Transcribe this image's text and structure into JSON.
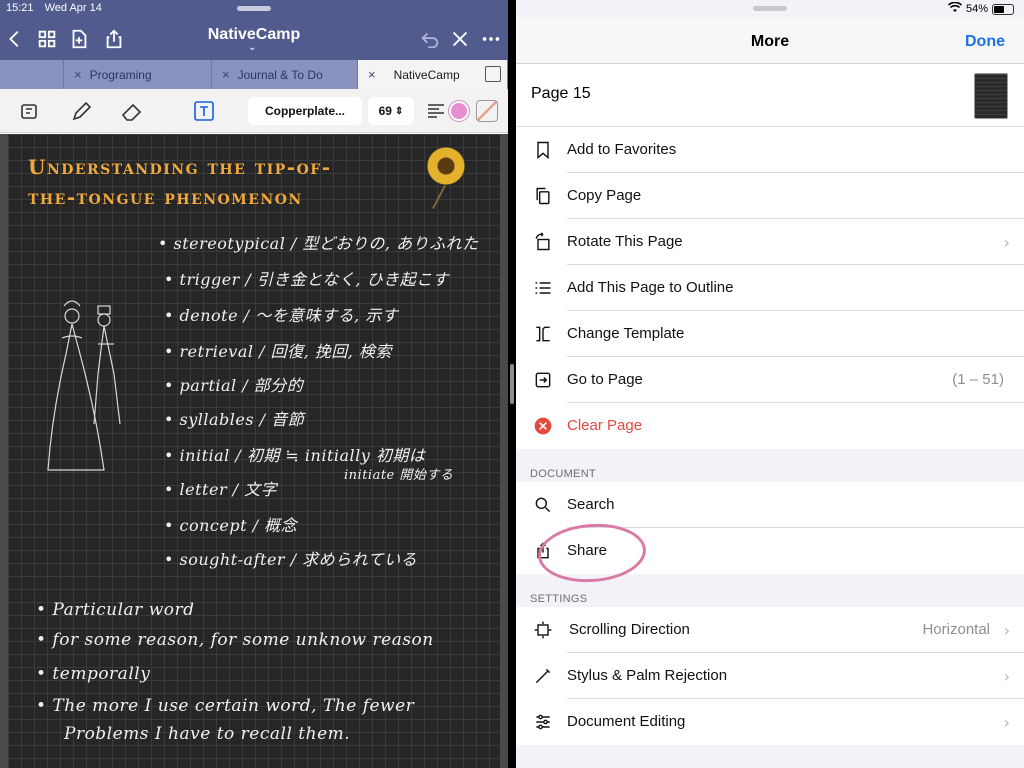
{
  "left": {
    "status": {
      "time": "15:21",
      "date": "Wed Apr 14"
    },
    "document_title": "NativeCamp",
    "tabs": [
      {
        "label": "Programing"
      },
      {
        "label": "Journal & To Do"
      },
      {
        "label": "NativeCamp",
        "active": true
      }
    ],
    "toolbar": {
      "font_name": "Copperplate...",
      "font_size": "69",
      "text_color": "#e58fd0"
    },
    "note": {
      "headline_line1": "Understanding the tip-of-",
      "headline_line2": "the-tongue phenomenon",
      "vocab": [
        "• stereotypical / 型どおりの, ありふれた",
        "• trigger / 引き金となく, ひき起こす",
        "• denote / ～を意味する, 示す",
        "• retrieval / 回復, 挽回, 検索",
        "• partial / 部分的",
        "• syllables / 音節",
        "• initial / 初期 ≒ initially 初期は",
        "• letter / 文字",
        "• concept / 概念",
        "• sought-after / 求められている"
      ],
      "initial_extra": "initiate 開始する",
      "bullets": [
        "• Particular word",
        "• for some reason, for some unknow reason",
        "• temporally",
        "• The more I use certain word, The fewer",
        "Problems I have to recall them."
      ]
    }
  },
  "right": {
    "status": {
      "battery": "54%"
    },
    "title": "More",
    "done_label": "Done",
    "page_label": "Page 15",
    "page_actions": [
      {
        "label": "Add to Favorites",
        "icon": "bookmark-icon"
      },
      {
        "label": "Copy Page",
        "icon": "copy-icon"
      },
      {
        "label": "Rotate This Page",
        "icon": "rotate-icon",
        "chevron": true
      },
      {
        "label": "Add This Page to Outline",
        "icon": "outline-icon"
      },
      {
        "label": "Change Template",
        "icon": "template-icon"
      },
      {
        "label": "Go to Page",
        "icon": "goto-icon",
        "value": "(1 – 51)"
      },
      {
        "label": "Clear Page",
        "icon": "clear-icon",
        "danger": true
      }
    ],
    "document_section": "DOCUMENT",
    "document_actions": [
      {
        "label": "Search",
        "icon": "search-icon"
      },
      {
        "label": "Share",
        "icon": "share-icon"
      }
    ],
    "settings_section": "SETTINGS",
    "settings_actions": [
      {
        "label": "Scrolling Direction",
        "icon": "scroll-direction-icon",
        "value": "Horizontal",
        "chevron": true
      },
      {
        "label": "Stylus & Palm Rejection",
        "icon": "stylus-icon",
        "chevron": true
      },
      {
        "label": "Document Editing",
        "icon": "sliders-icon",
        "chevron": true
      }
    ],
    "danger_color": "#e5483d",
    "accent_color": "#1a73e8"
  }
}
